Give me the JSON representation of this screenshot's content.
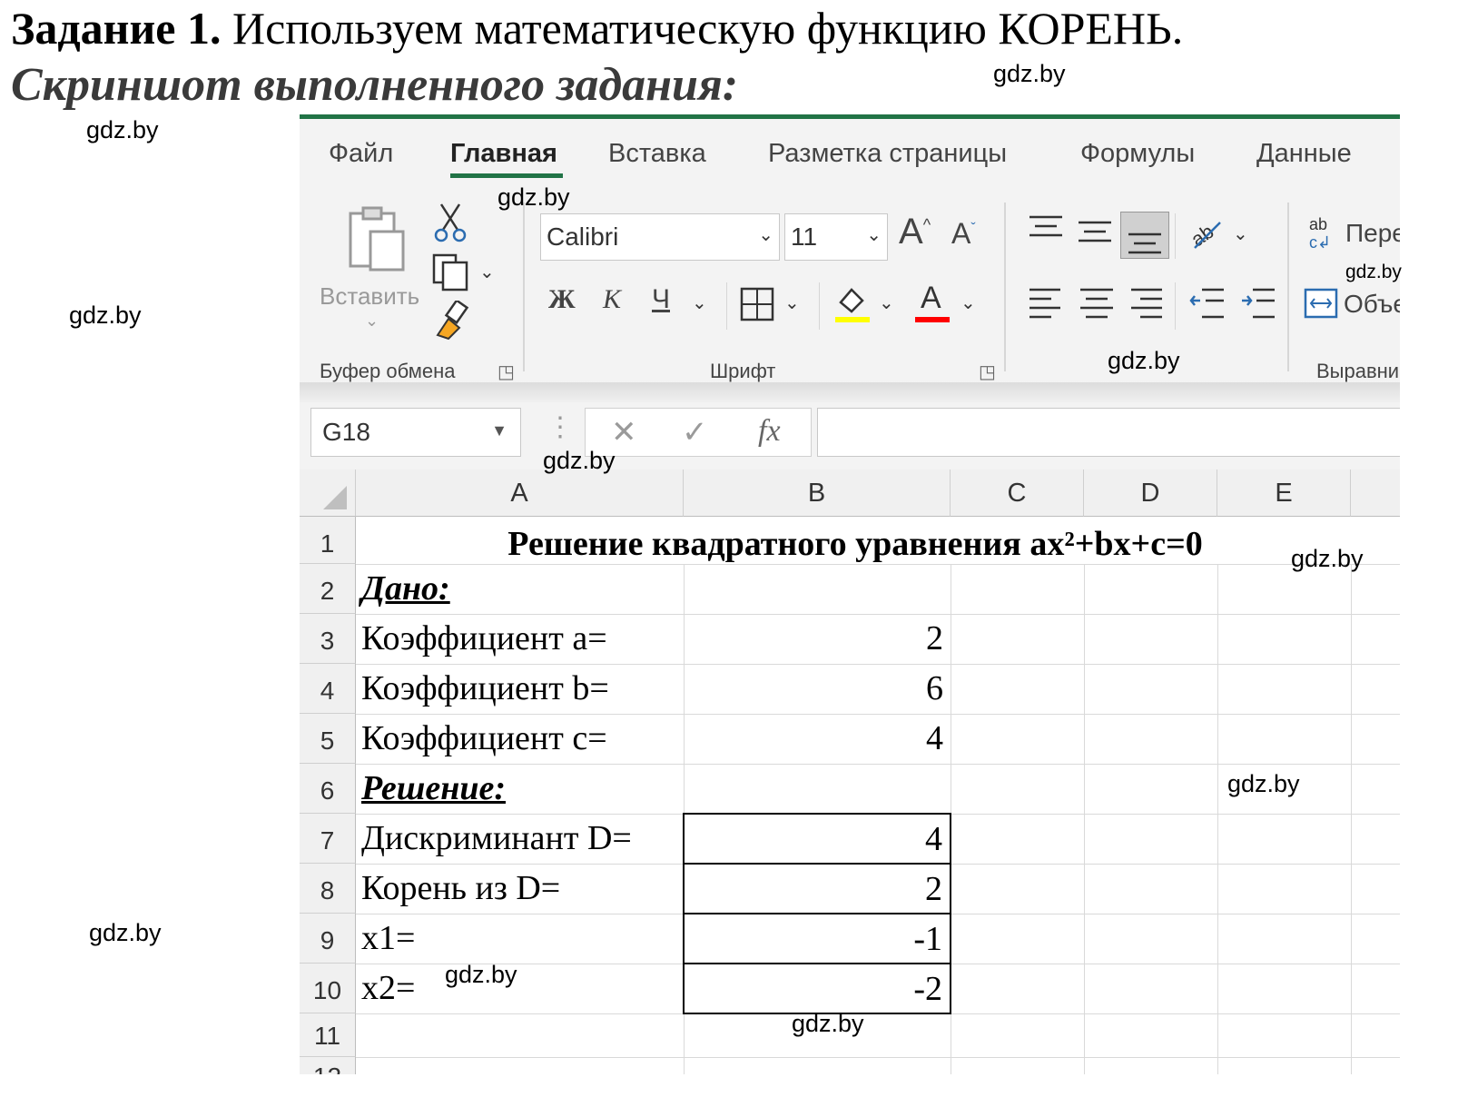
{
  "task": {
    "title_bold": "Задание 1.",
    "title_rest": " Используем математическую функцию КОРЕНЬ.",
    "subtitle": "Скриншот выполненного задания:"
  },
  "watermark": "gdz.by",
  "menu": {
    "items": [
      "Файл",
      "Главная",
      "Вставка",
      "Разметка страницы",
      "Формулы",
      "Данные"
    ],
    "active_index": 1
  },
  "ribbon": {
    "clipboard": {
      "paste_label": "Вставить",
      "group_label": "Буфер обмена"
    },
    "font": {
      "font_name": "Calibri",
      "font_size": "11",
      "bold": "Ж",
      "italic": "К",
      "underline": "Ч",
      "font_color_glyph": "А",
      "group_label": "Шрифт",
      "highlight_color": "#ffff00",
      "font_color": "#ff0000"
    },
    "alignment": {
      "wrap_label": "Пере",
      "merge_label": "Объе",
      "group_label": "Выравни"
    }
  },
  "formula_bar": {
    "name_box": "G18",
    "fx": "fx",
    "value": ""
  },
  "columns": [
    "A",
    "B",
    "C",
    "D",
    "E"
  ],
  "rows": [
    "1",
    "2",
    "3",
    "4",
    "5",
    "6",
    "7",
    "8",
    "9",
    "10",
    "11",
    "12"
  ],
  "sheet": {
    "title": "Решение квадратного уравнения ax²+bx+c=0",
    "given": "Дано:",
    "a_label": "Коэффициент a=",
    "a_value": "2",
    "b_label": "Коэффициент b=",
    "b_value": "6",
    "c_label": "Коэффициент c=",
    "c_value": "4",
    "solution": "Решение:",
    "d_label": "Дискриминант D=",
    "d_value": "4",
    "sqrt_label": "Корень из D=",
    "sqrt_value": "2",
    "x1_label": "x1=",
    "x1_value": "-1",
    "x2_label": "x2=",
    "x2_value": "-2"
  },
  "colors": {
    "excel_green": "#217346"
  }
}
